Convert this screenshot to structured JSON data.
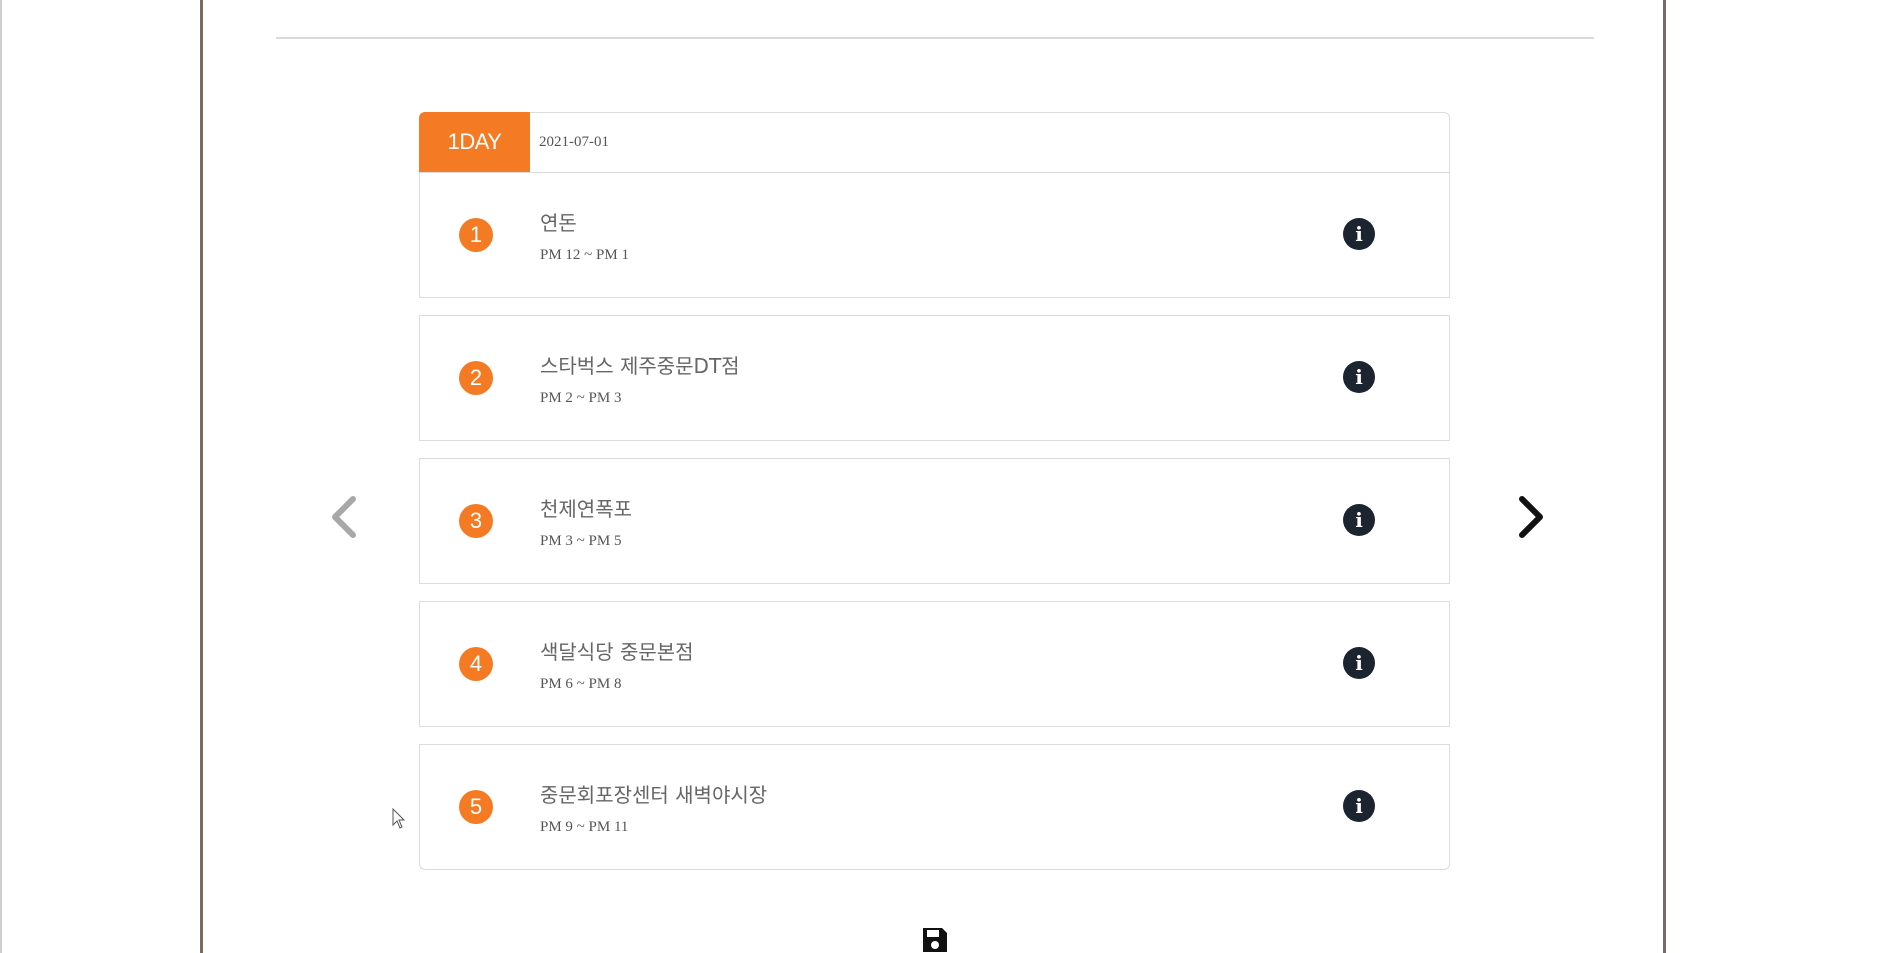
{
  "schedule": {
    "day_label": "1DAY",
    "date": "2021-07-01",
    "stops": [
      {
        "number": "1",
        "name": "연돈",
        "time": "PM 12 ~ PM 1"
      },
      {
        "number": "2",
        "name": "스타벅스 제주중문DT점",
        "time": "PM 2 ~ PM 3"
      },
      {
        "number": "3",
        "name": "천제연폭포",
        "time": "PM 3 ~ PM 5"
      },
      {
        "number": "4",
        "name": "색달식당 중문본점",
        "time": "PM 6 ~ PM 8"
      },
      {
        "number": "5",
        "name": "중문회포장센터 새벽야시장",
        "time": "PM 9 ~ PM 11"
      }
    ]
  },
  "icons": {
    "info": "info-icon",
    "prev": "chevron-left-icon",
    "next": "chevron-right-icon",
    "save": "floppy-disk-icon",
    "cursor": "mouse-pointer-icon"
  },
  "colors": {
    "accent": "#f47a24",
    "info_bg": "#1c2430",
    "border": "#dcdcdc",
    "frame": "#7a6a64"
  }
}
